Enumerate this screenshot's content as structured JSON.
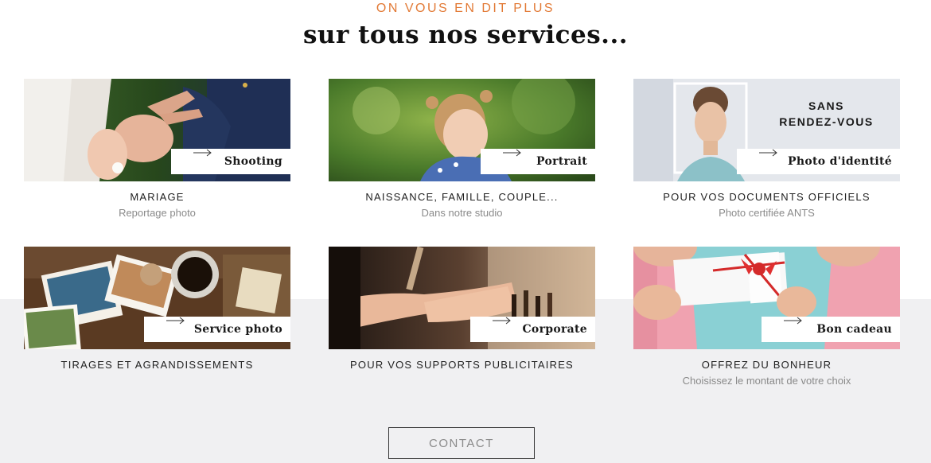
{
  "header": {
    "eyebrow": "ON VOUS EN DIT PLUS",
    "title": "sur tous nos services..."
  },
  "services": [
    {
      "tag": "Shooting",
      "heading": "MARIAGE",
      "sub": "Reportage photo"
    },
    {
      "tag": "Portrait",
      "heading": "NAISSANCE, FAMILLE, COUPLE...",
      "sub": "Dans notre studio"
    },
    {
      "tag": "Photo d'identité",
      "heading": "POUR VOS DOCUMENTS OFFICIELS",
      "sub": "Photo certifiée ANTS",
      "overlay_line1": "SANS",
      "overlay_line2": "RENDEZ-VOUS"
    },
    {
      "tag": "Service photo",
      "heading": "TIRAGES ET AGRANDISSEMENTS",
      "sub": ""
    },
    {
      "tag": "Corporate",
      "heading": "POUR VOS SUPPORTS PUBLICITAIRES",
      "sub": ""
    },
    {
      "tag": "Bon cadeau",
      "heading": "OFFREZ DU BONHEUR",
      "sub": "Choisissez le montant de votre choix"
    }
  ],
  "contact": {
    "label": "CONTACT"
  },
  "colors": {
    "accent": "#e27a36",
    "band": "#f0f0f2",
    "text": "#111111",
    "muted": "#8a8a8a"
  }
}
